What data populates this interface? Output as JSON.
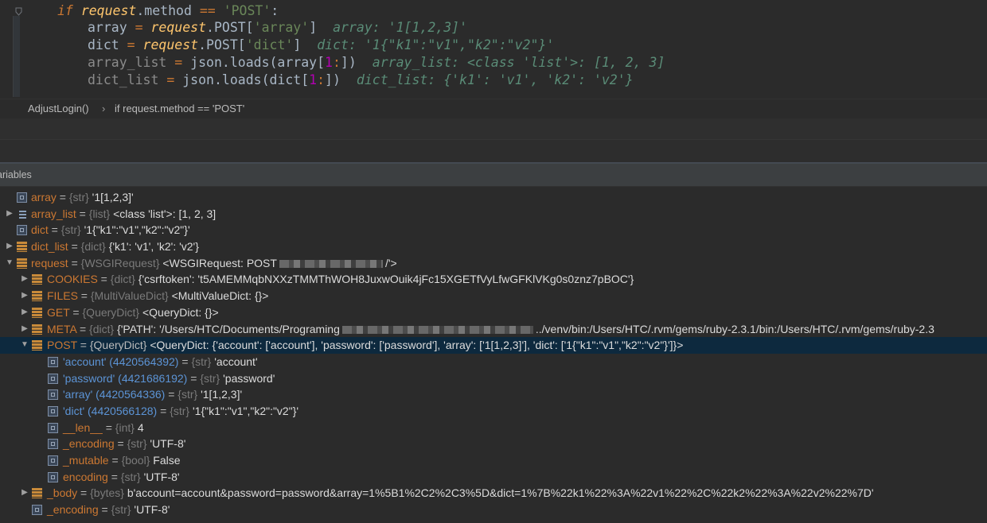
{
  "editor": {
    "lines": [
      {
        "indent": "l-indent2",
        "parts": [
          {
            "t": "if",
            "c": "kw"
          },
          {
            "t": " ",
            "c": "plain"
          },
          {
            "t": "request",
            "c": "req"
          },
          {
            "t": ".method ",
            "c": "plain"
          },
          {
            "t": "==",
            "c": "op"
          },
          {
            "t": " ",
            "c": "plain"
          },
          {
            "t": "'POST'",
            "c": "str"
          },
          {
            "t": ":",
            "c": "plain"
          }
        ]
      },
      {
        "indent": "l-indent3",
        "parts": [
          {
            "t": "array ",
            "c": "plain"
          },
          {
            "t": "=",
            "c": "op"
          },
          {
            "t": " ",
            "c": "plain"
          },
          {
            "t": "request",
            "c": "req"
          },
          {
            "t": ".POST[",
            "c": "plain"
          },
          {
            "t": "'array'",
            "c": "str"
          },
          {
            "t": "]",
            "c": "plain"
          }
        ],
        "hint": "array: '1[1,2,3]'"
      },
      {
        "indent": "l-indent3",
        "parts": [
          {
            "t": "dict ",
            "c": "plain"
          },
          {
            "t": "=",
            "c": "op"
          },
          {
            "t": " ",
            "c": "plain"
          },
          {
            "t": "request",
            "c": "req"
          },
          {
            "t": ".POST[",
            "c": "plain"
          },
          {
            "t": "'dict'",
            "c": "str"
          },
          {
            "t": "]",
            "c": "plain"
          }
        ],
        "hint": "dict: '1{\"k1\":\"v1\",\"k2\":\"v2\"}'"
      },
      {
        "indent": "l-indent3",
        "parts": [
          {
            "t": "array_list ",
            "c": "muted"
          },
          {
            "t": "=",
            "c": "op"
          },
          {
            "t": " json.",
            "c": "plain"
          },
          {
            "t": "loads",
            "c": "fn"
          },
          {
            "t": "(array[",
            "c": "plain"
          },
          {
            "t": "1",
            "c": "num"
          },
          {
            "t": ":",
            "c": "op"
          },
          {
            "t": "])",
            "c": "plain"
          }
        ],
        "hint": "array_list: <class 'list'>: [1, 2, 3]"
      },
      {
        "indent": "l-indent3",
        "parts": [
          {
            "t": "dict_list ",
            "c": "muted"
          },
          {
            "t": "=",
            "c": "op"
          },
          {
            "t": " json.",
            "c": "plain"
          },
          {
            "t": "loads",
            "c": "fn"
          },
          {
            "t": "(dict[",
            "c": "plain"
          },
          {
            "t": "1",
            "c": "num"
          },
          {
            "t": ":",
            "c": "op"
          },
          {
            "t": "])",
            "c": "plain"
          }
        ],
        "hint": "dict_list: {'k1': 'v1', 'k2': 'v2'}"
      }
    ]
  },
  "breadcrumb": {
    "function": "AdjustLogin()",
    "separator": "›",
    "statement": "if request.method == 'POST'"
  },
  "variables_panel": {
    "title": "ariables"
  },
  "variables": [
    {
      "level": 0,
      "arrow": "",
      "icon": "str",
      "name": "array",
      "type": "{str}",
      "value": "'1[1,2,3]'"
    },
    {
      "level": 0,
      "arrow": "▶",
      "icon": "list",
      "name": "array_list",
      "type": "{list}",
      "value": "<class 'list'>: [1, 2, 3]"
    },
    {
      "level": 0,
      "arrow": "",
      "icon": "str",
      "name": "dict",
      "type": "{str}",
      "value": "'1{\"k1\":\"v1\",\"k2\":\"v2\"}'"
    },
    {
      "level": 0,
      "arrow": "▶",
      "icon": "obj",
      "name": "dict_list",
      "type": "{dict}",
      "value": "{'k1': 'v1', 'k2': 'v2'}"
    },
    {
      "level": 0,
      "arrow": "▼",
      "icon": "obj",
      "name": "request",
      "type": "{WSGIRequest}",
      "value": "<WSGIRequest: POST",
      "blur": 130,
      "tail": "/'>"
    },
    {
      "level": 1,
      "arrow": "▶",
      "icon": "obj",
      "name": "COOKIES",
      "type": "{dict}",
      "value": "{'csrftoken': 't5AMEMMqbNXXzTMMThWOH8JuxwOuik4jFc15XGETfVyLfwGFKlVKg0s0znz7pBOC'}"
    },
    {
      "level": 1,
      "arrow": "▶",
      "icon": "obj",
      "name": "FILES",
      "type": "{MultiValueDict}",
      "value": "<MultiValueDict: {}>"
    },
    {
      "level": 1,
      "arrow": "▶",
      "icon": "obj",
      "name": "GET",
      "type": "{QueryDict}",
      "value": "<QueryDict: {}>"
    },
    {
      "level": 1,
      "arrow": "▶",
      "icon": "obj",
      "name": "META",
      "type": "{dict}",
      "value": "{'PATH': '/Users/HTC/Documents/Programing",
      "blur": 240,
      "tail": "../venv/bin:/Users/HTC/.rvm/gems/ruby-2.3.1/bin:/Users/HTC/.rvm/gems/ruby-2.3"
    },
    {
      "level": 1,
      "arrow": "▼",
      "icon": "obj",
      "name": "POST",
      "type": "{QueryDict}",
      "value": "<QueryDict: {'account': ['account'], 'password': ['password'], 'array': ['1[1,2,3]'], 'dict': ['1{\"k1\":\"v1\",\"k2\":\"v2\"}']}>",
      "selected": true,
      "bright": true
    },
    {
      "level": 2,
      "arrow": "",
      "icon": "str",
      "name": "'account' (4420564392)",
      "key": true,
      "type": "{str}",
      "value": "'account'"
    },
    {
      "level": 2,
      "arrow": "",
      "icon": "str",
      "name": "'password' (4421686192)",
      "key": true,
      "type": "{str}",
      "value": "'password'"
    },
    {
      "level": 2,
      "arrow": "",
      "icon": "str",
      "name": "'array' (4420564336)",
      "key": true,
      "type": "{str}",
      "value": "'1[1,2,3]'"
    },
    {
      "level": 2,
      "arrow": "",
      "icon": "str",
      "name": "'dict' (4420566128)",
      "key": true,
      "type": "{str}",
      "value": "'1{\"k1\":\"v1\",\"k2\":\"v2\"}'"
    },
    {
      "level": 2,
      "arrow": "",
      "icon": "str",
      "name": "__len__",
      "type": "{int}",
      "value": "4"
    },
    {
      "level": 2,
      "arrow": "",
      "icon": "str",
      "name": "_encoding",
      "type": "{str}",
      "value": "'UTF-8'"
    },
    {
      "level": 2,
      "arrow": "",
      "icon": "str",
      "name": "_mutable",
      "type": "{bool}",
      "value": "False"
    },
    {
      "level": 2,
      "arrow": "",
      "icon": "str",
      "name": "encoding",
      "type": "{str}",
      "value": "'UTF-8'"
    },
    {
      "level": 1,
      "arrow": "▶",
      "icon": "obj",
      "name": "_body",
      "type": "{bytes}",
      "value": "b'account=account&password=password&array=1%5B1%2C2%2C3%5D&dict=1%7B%22k1%22%3A%22v1%22%2C%22k2%22%3A%22v2%22%7D'"
    },
    {
      "level": 1,
      "arrow": "",
      "icon": "str",
      "name": "_encoding",
      "type": "{str}",
      "value": "'UTF-8'"
    }
  ]
}
